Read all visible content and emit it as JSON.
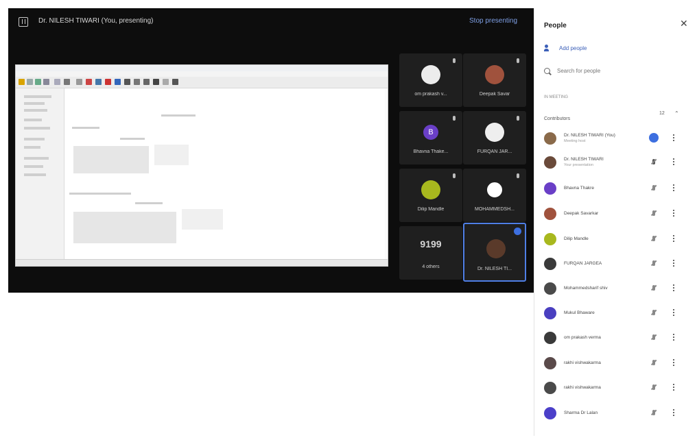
{
  "call": {
    "presenter_text": "Dr. NILESH TIWARI (You, presenting)",
    "stop_presenting": "Stop presenting"
  },
  "tiles": [
    {
      "name": "om prakash v...",
      "avatar": "photo",
      "color": "#e8e8e8"
    },
    {
      "name": "Deepak Savar",
      "avatar": "photo",
      "color": "#a0523d"
    },
    {
      "name": "Bhavna Thake...",
      "avatar": "initial",
      "initial": "B",
      "color": "#6a3fc7"
    },
    {
      "name": "FURQAN JAR...",
      "avatar": "photo",
      "color": "#eeeeee"
    },
    {
      "name": "Dilip Mandle",
      "avatar": "photo",
      "color": "#a8b81e"
    },
    {
      "name": "MOHAMMEDSH...",
      "avatar": "photo",
      "color": "#ffffff"
    },
    {
      "name": "4 others",
      "avatar": "count",
      "text": "9199"
    },
    {
      "name": "Dr. NILESH TI...",
      "avatar": "photo",
      "color": "#5a3a2a",
      "active": true
    }
  ],
  "people": {
    "title": "People",
    "close_icon": "close-icon",
    "add_label": "Add people",
    "search_placeholder": "Search for people",
    "section_label": "IN MEETING",
    "group_label": "Contributors",
    "group_count": "12",
    "list": [
      {
        "name": "Dr. NILESH TIWARI (You)",
        "sub": "Meeting host",
        "color": "#8a6a4a",
        "status": "speaking"
      },
      {
        "name": "Dr. NILESH TIWARI",
        "sub": "Your presentation",
        "color": "#6a4a3a",
        "status": "presenting"
      },
      {
        "name": "Bhavna Thakre",
        "sub": "",
        "color": "#6a3fc7",
        "status": "muted"
      },
      {
        "name": "Deepak Savarkar",
        "sub": "",
        "color": "#a0523d",
        "status": "muted"
      },
      {
        "name": "Dilip Mandle",
        "sub": "",
        "color": "#a8b81e",
        "status": "muted"
      },
      {
        "name": "FURQAN JARGEA",
        "sub": "",
        "color": "#3a3a3a",
        "status": "muted"
      },
      {
        "name": "Mohammedsharif shiv",
        "sub": "",
        "color": "#4a4a4a",
        "status": "muted"
      },
      {
        "name": "Mukul Bhaware",
        "sub": "",
        "color": "#4a3fc0",
        "status": "muted"
      },
      {
        "name": "om prakash verma",
        "sub": "",
        "color": "#3a3a3a",
        "status": "muted"
      },
      {
        "name": "rakhi vishwakarma",
        "sub": "",
        "color": "#5a4a4a",
        "status": "muted"
      },
      {
        "name": "rakhi vishwakarma",
        "sub": "",
        "color": "#4a4a4a",
        "status": "muted"
      },
      {
        "name": "Sharma Dr Lalan",
        "sub": "",
        "color": "#4b3fc9",
        "status": "muted"
      }
    ]
  }
}
